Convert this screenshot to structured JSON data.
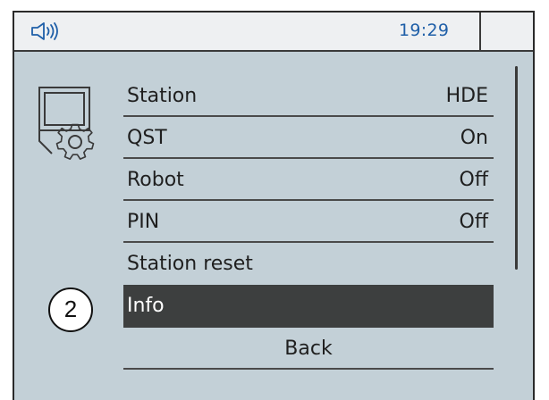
{
  "status_bar": {
    "speaker_icon": "speaker-volume-icon",
    "time": "19:29"
  },
  "menu_icon": "station-settings-icon",
  "callout": {
    "number": "2"
  },
  "menu": {
    "items": [
      {
        "label": "Station",
        "value": "HDE"
      },
      {
        "label": "QST",
        "value": "On"
      },
      {
        "label": "Robot",
        "value": "Off"
      },
      {
        "label": "PIN",
        "value": "Off"
      },
      {
        "label": "Station reset",
        "value": ""
      },
      {
        "label": "Info",
        "value": "",
        "selected": true
      },
      {
        "label": "Back",
        "value": ""
      }
    ]
  },
  "colors": {
    "screen_background": "#c3d0d7",
    "status_bar_background": "#eef0f2",
    "clock_color": "#1f5fa8",
    "selected_background": "#3d3f3f",
    "text_color": "#1f1f1f"
  }
}
